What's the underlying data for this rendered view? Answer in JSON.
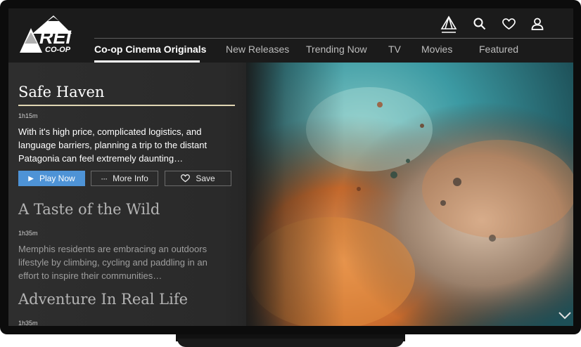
{
  "brand": {
    "logo_text_main": "REI",
    "logo_text_sub": "CO-OP"
  },
  "header_icons": [
    "camp-icon",
    "search-icon",
    "heart-icon",
    "user-icon"
  ],
  "nav": {
    "tabs": [
      {
        "label": "Co-op Cinema Originals",
        "active": true
      },
      {
        "label": "New Releases"
      },
      {
        "label": "Trending Now"
      },
      {
        "label": "TV"
      },
      {
        "label": "Movies"
      },
      {
        "label": "Featured"
      }
    ]
  },
  "featured": {
    "title": "Safe Haven",
    "duration": "1h15m",
    "description": "With it's high price, complicated logistics, and language barriers, planning a trip to the distant Patagonia can feel extremely daunting…",
    "play_label": "Play Now",
    "more_label": "More Info",
    "save_label": "Save"
  },
  "list": [
    {
      "title": "A Taste of the Wild",
      "duration": "1h35m",
      "description": "Memphis residents are embracing an outdoors lifestyle by climbing, cycling and paddling in an effort to inspire their communities…"
    },
    {
      "title": "Adventure In Real Life",
      "duration": "1h35m"
    }
  ],
  "colors": {
    "accent": "#4E93D6",
    "title_rule": "#E0D6B3",
    "background": "#252525"
  }
}
